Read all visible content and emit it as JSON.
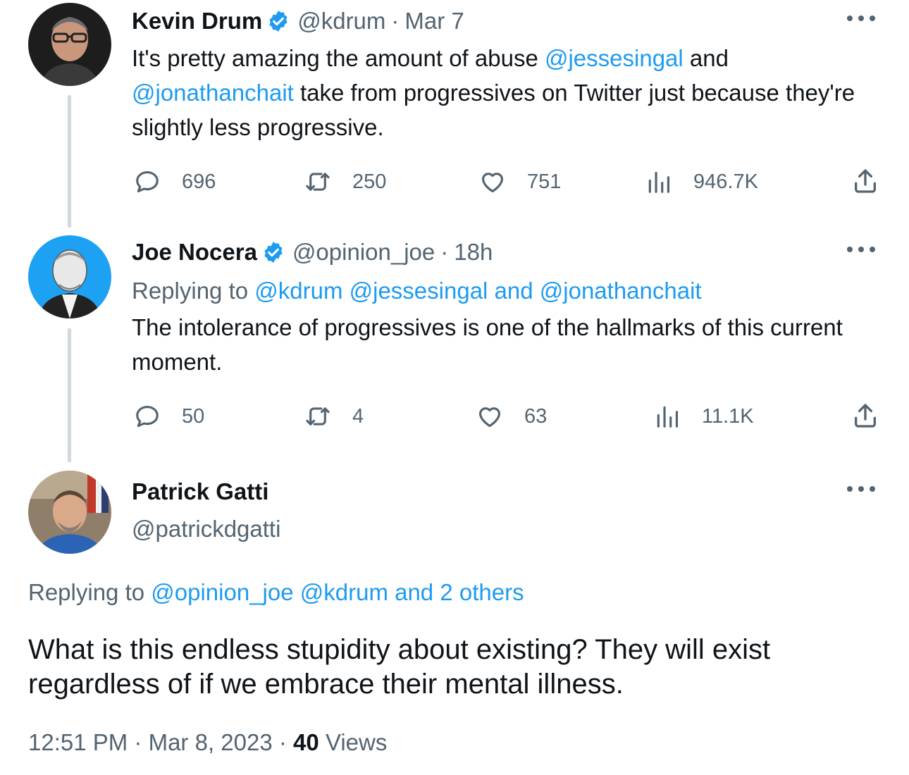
{
  "colors": {
    "link": "#1d9bf0",
    "secondary_text": "#536471",
    "primary_text": "#0f1419",
    "thread_line": "#cfd9de",
    "verified": "#1d9bf0"
  },
  "tweets": [
    {
      "name": "Kevin Drum",
      "verified": true,
      "handle": "@kdrum",
      "time": "Mar 7",
      "text_parts": {
        "t1": "It's pretty amazing the amount of abuse ",
        "m1": "@jessesingal",
        "t2": " and ",
        "m2": "@jonathanchait",
        "t3": " take from progressives on Twitter just because they're slightly less progressive."
      },
      "stats": {
        "replies": "696",
        "retweets": "250",
        "likes": "751",
        "views": "946.7K"
      }
    },
    {
      "name": "Joe Nocera",
      "verified": true,
      "handle": "@opinion_joe",
      "time": "18h",
      "replying": {
        "prefix": "Replying to ",
        "targets": "@kdrum @jessesingal and @jonathanchait"
      },
      "text": "The intolerance of progressives is one of the hallmarks of this current moment.",
      "stats": {
        "replies": "50",
        "retweets": "4",
        "likes": "63",
        "views": "11.1K"
      }
    }
  ],
  "main_tweet": {
    "name": "Patrick Gatti",
    "handle": "@patrickdgatti",
    "replying": {
      "prefix": "Replying to ",
      "targets": "@opinion_joe @kdrum and 2 others"
    },
    "text": "What is this endless stupidity about existing?  They will exist regardless of if we embrace their mental illness.",
    "time": "12:51 PM",
    "date": "Mar 8, 2023",
    "views_count": "40",
    "views_label": "Views"
  },
  "icons": {
    "reply": "reply-icon",
    "retweet": "retweet-icon",
    "like": "heart-icon",
    "views": "views-icon",
    "share": "share-icon",
    "more": "more-icon",
    "verified": "verified-badge-icon"
  }
}
